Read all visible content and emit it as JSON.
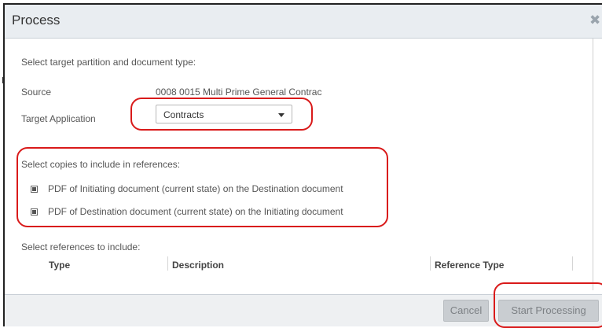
{
  "dialog": {
    "title": "Process",
    "close_icon": "times-icon",
    "instruction": "Select target partition and document type:",
    "source_label": "Source",
    "source_value": "0008 0015 Multi Prime General Contrac",
    "target_application_label": "Target Application",
    "target_application": {
      "selected": "Contracts"
    },
    "copies_heading": "Select copies to include in references:",
    "copies": [
      {
        "label": "PDF of Initiating document (current state) on the Destination document",
        "checked": true
      },
      {
        "label": "PDF of Destination document (current state) on the Initiating document",
        "checked": true
      }
    ],
    "references_heading": "Select references to include:",
    "references_columns": [
      "Type",
      "Description",
      "Reference Type"
    ]
  },
  "footer": {
    "cancel_label": "Cancel",
    "start_label": "Start Processing"
  },
  "colors": {
    "highlight": "#d91a1a",
    "titlebar": "#e9edf1",
    "button": "#c9cdd1"
  }
}
